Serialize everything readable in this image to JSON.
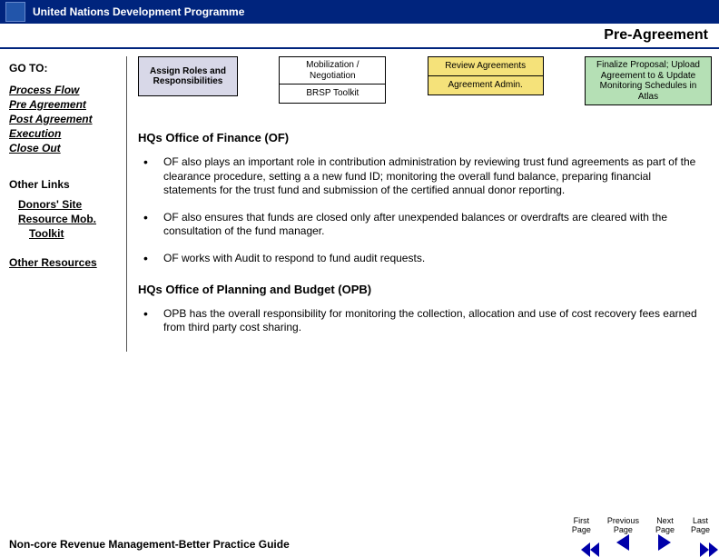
{
  "header": {
    "org": "United Nations Development Programme"
  },
  "page_title": "Pre-Agreement",
  "sidebar": {
    "goto_label": "GO TO:",
    "nav": [
      "Process Flow",
      "Pre Agreement",
      "Post Agreement",
      "Execution",
      "Close Out"
    ],
    "other_label": "Other Links",
    "ext1a": "Donors' Site",
    "ext1b": "Resource Mob.",
    "ext1c": "Toolkit",
    "ext2": "Other Resources"
  },
  "boxes": {
    "b1": "Assign Roles and Responsibilities",
    "b2a": "Mobilization / Negotiation",
    "b2b": "BRSP Toolkit",
    "b3a": "Review Agreements",
    "b3b": "Agreement Admin.",
    "b4": "Finalize Proposal; Upload Agreement to & Update Monitoring Schedules in Atlas"
  },
  "sections": {
    "s1_title": "HQs Office of Finance (OF)",
    "s1_b1": "OF also plays an important role in contribution administration by reviewing trust fund agreements as part of the  clearance procedure, setting a a new fund ID; monitoring the overall  fund balance, preparing financial statements for the trust fund and submission of the certified annual donor reporting.",
    "s1_b2": "OF also ensures that  funds are closed only after unexpended balances or overdrafts are cleared with the consultation of the fund manager.",
    "s1_b3": "OF works with Audit to respond to fund audit requests.",
    "s2_title": "HQs Office of Planning and Budget (OPB)",
    "s2_b1": "OPB has the overall responsibility for monitoring the collection, allocation and use of cost recovery fees earned from third party cost sharing."
  },
  "footer": {
    "guide": "Non-core Revenue Management-Better Practice Guide",
    "nav": {
      "first_a": "First",
      "first_b": "Page",
      "prev_a": "Previous",
      "prev_b": "Page",
      "next_a": "Next",
      "next_b": "Page",
      "last_a": "Last",
      "last_b": "Page"
    }
  }
}
